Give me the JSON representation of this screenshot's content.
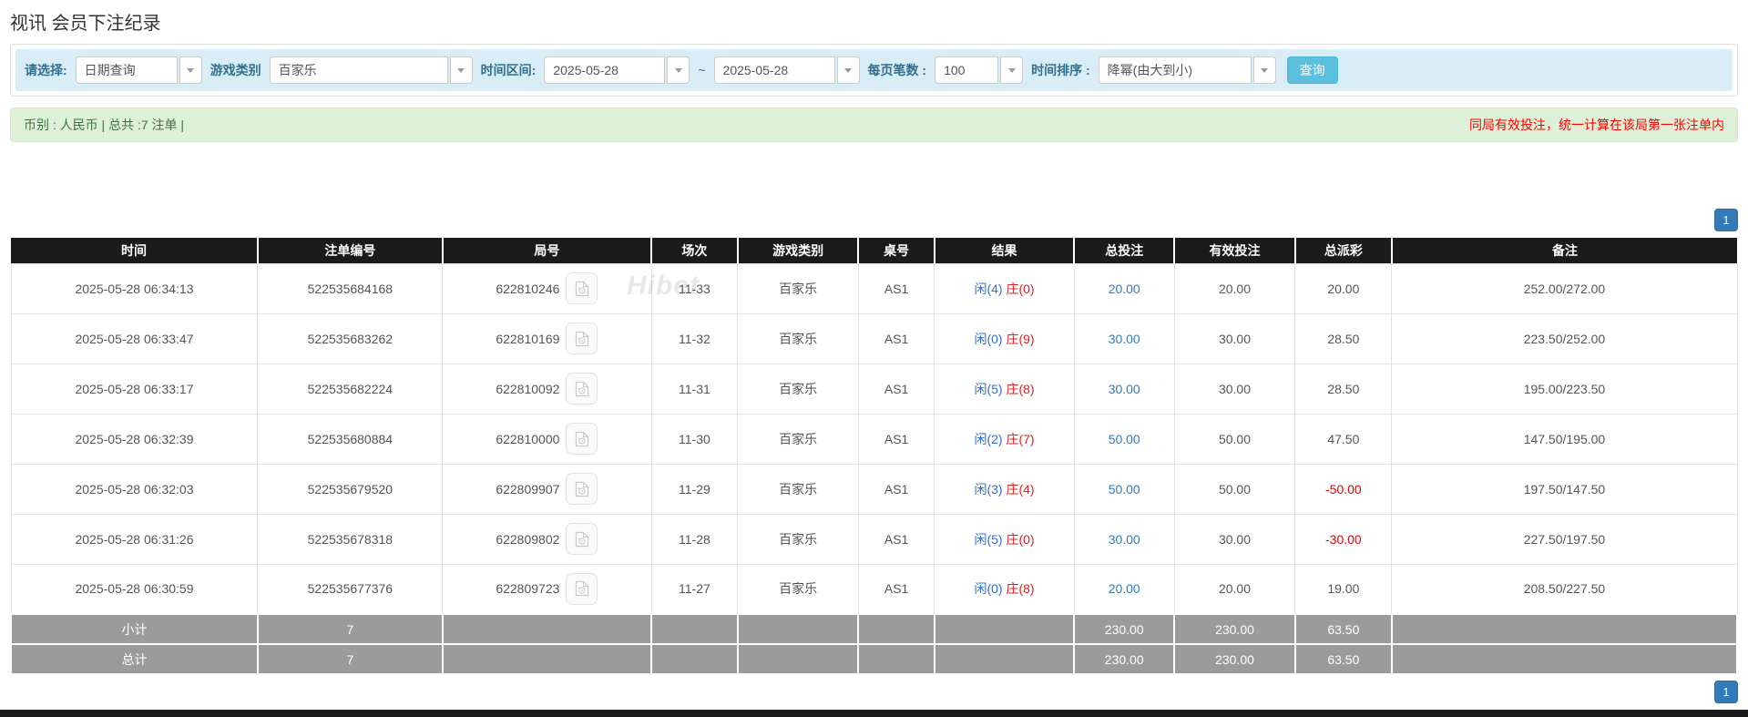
{
  "page": {
    "title": "视讯 会员下注纪录"
  },
  "filters": {
    "select_label": "请选择:",
    "select_value": "日期查询",
    "game_type_label": "游戏类别",
    "game_type_value": "百家乐",
    "time_range_label": "时间区间:",
    "date_from": "2025-05-28",
    "range_separator": "~",
    "date_to": "2025-05-28",
    "page_size_label": "每页笔数 :",
    "page_size_value": "100",
    "sort_label": "时间排序 :",
    "sort_value": "降幂(由大到小)",
    "query_button": "查询"
  },
  "summary": {
    "left": "币别 : 人民币 | 总共 :7 注单 |",
    "right": "同局有效投注，统一计算在该局第一张注单内"
  },
  "pagination": {
    "page": "1"
  },
  "watermark": "Hibet",
  "icons": {
    "dropdown": "caret-down-icon",
    "round_cell": "video-file-icon"
  },
  "colors": {
    "filter_bg": "#d9edf7",
    "filter_label": "#31708f",
    "query_button": "#5bc0de",
    "summary_bg": "#dff0d8",
    "summary_text": "#3c763d",
    "alert_red": "#ff0000",
    "table_header_bg": "#1b1b1b",
    "table_footer_bg": "#9b9b9b",
    "link_blue": "#337ab7",
    "player_blue": "#2e6fd8",
    "banker_red": "#dd2222",
    "negative_red": "#e60000"
  },
  "table": {
    "headers": [
      "时间",
      "注单编号",
      "局号",
      "场次",
      "游戏类别",
      "桌号",
      "结果",
      "总投注",
      "有效投注",
      "总派彩",
      "备注"
    ],
    "rows": [
      {
        "time": "2025-05-28 06:34:13",
        "bet_id": "522535684168",
        "round": "622810246",
        "session": "11-33",
        "game": "百家乐",
        "table_no": "AS1",
        "result_player": "闲(4)",
        "result_banker": "庄(0)",
        "total_bet": "20.00",
        "valid_bet": "20.00",
        "payout": "20.00",
        "remark": "252.00/272.00"
      },
      {
        "time": "2025-05-28 06:33:47",
        "bet_id": "522535683262",
        "round": "622810169",
        "session": "11-32",
        "game": "百家乐",
        "table_no": "AS1",
        "result_player": "闲(0)",
        "result_banker": "庄(9)",
        "total_bet": "30.00",
        "valid_bet": "30.00",
        "payout": "28.50",
        "remark": "223.50/252.00"
      },
      {
        "time": "2025-05-28 06:33:17",
        "bet_id": "522535682224",
        "round": "622810092",
        "session": "11-31",
        "game": "百家乐",
        "table_no": "AS1",
        "result_player": "闲(5)",
        "result_banker": "庄(8)",
        "total_bet": "30.00",
        "valid_bet": "30.00",
        "payout": "28.50",
        "remark": "195.00/223.50"
      },
      {
        "time": "2025-05-28 06:32:39",
        "bet_id": "522535680884",
        "round": "622810000",
        "session": "11-30",
        "game": "百家乐",
        "table_no": "AS1",
        "result_player": "闲(2)",
        "result_banker": "庄(7)",
        "total_bet": "50.00",
        "valid_bet": "50.00",
        "payout": "47.50",
        "remark": "147.50/195.00"
      },
      {
        "time": "2025-05-28 06:32:03",
        "bet_id": "522535679520",
        "round": "622809907",
        "session": "11-29",
        "game": "百家乐",
        "table_no": "AS1",
        "result_player": "闲(3)",
        "result_banker": "庄(4)",
        "total_bet": "50.00",
        "valid_bet": "50.00",
        "payout": "-50.00",
        "remark": "197.50/147.50"
      },
      {
        "time": "2025-05-28 06:31:26",
        "bet_id": "522535678318",
        "round": "622809802",
        "session": "11-28",
        "game": "百家乐",
        "table_no": "AS1",
        "result_player": "闲(5)",
        "result_banker": "庄(0)",
        "total_bet": "30.00",
        "valid_bet": "30.00",
        "payout": "-30.00",
        "remark": "227.50/197.50"
      },
      {
        "time": "2025-05-28 06:30:59",
        "bet_id": "522535677376",
        "round": "622809723",
        "session": "11-27",
        "game": "百家乐",
        "table_no": "AS1",
        "result_player": "闲(0)",
        "result_banker": "庄(8)",
        "total_bet": "20.00",
        "valid_bet": "20.00",
        "payout": "19.00",
        "remark": "208.50/227.50"
      }
    ],
    "subtotal": {
      "label": "小计",
      "count": "7",
      "total_bet": "230.00",
      "valid_bet": "230.00",
      "payout": "63.50"
    },
    "total": {
      "label": "总计",
      "count": "7",
      "total_bet": "230.00",
      "valid_bet": "230.00",
      "payout": "63.50"
    }
  }
}
